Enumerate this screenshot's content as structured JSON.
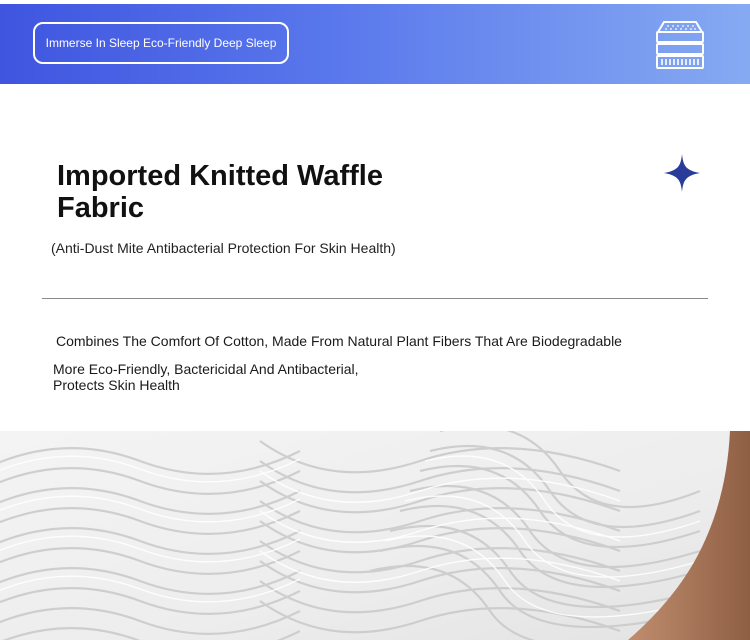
{
  "banner": {
    "tag_text": "Immerse In Sleep Eco-Friendly Deep Sleep",
    "icon": "mattress-icon",
    "gradient_start": "#3f55e0",
    "gradient_end": "#86aaf2"
  },
  "feature": {
    "title": "Imported Knitted Waffle Fabric",
    "subtitle": "(Anti-Dust Mite Antibacterial Protection For Skin Health)",
    "decor_icon": "sparkle-star-icon",
    "accent_color": "#2a3c9a"
  },
  "description": {
    "line1": "Combines The Comfort Of Cotton, Made From Natural Plant Fibers That Are Biodegradable",
    "line2": "More Eco-Friendly, Bactericidal And Antibacterial, Protects Skin Health"
  },
  "photo": {
    "subject": "fabric-texture-photo"
  }
}
